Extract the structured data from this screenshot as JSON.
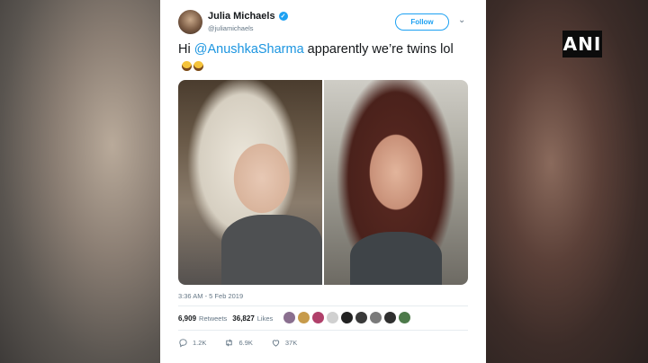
{
  "tweet": {
    "display_name": "Julia Michaels",
    "handle": "@juliamichaels",
    "follow_label": "Follow",
    "text_prefix": "Hi ",
    "mention": "@AnushkaSharma",
    "text_suffix": " apparently we’re twins lol",
    "timestamp": "3:36 AM - 5 Feb 2019",
    "retweets_count": "6,909",
    "retweets_label": "Retweets",
    "likes_count": "36,827",
    "likes_label": "Likes",
    "replies": "1.2K",
    "retweets_short": "6.9K",
    "likes_short": "37K"
  },
  "overlay": {
    "logo_text": "ANI"
  },
  "icons": [
    "verified-badge-icon",
    "chevron-down-icon",
    "reply-icon",
    "retweet-icon",
    "like-icon"
  ],
  "colors": {
    "twitter_blue": "#1da1f2",
    "mention_blue": "#1b95e0",
    "text_dark": "#14171a",
    "text_muted": "#657786"
  },
  "likers": [
    "#8a6f8f",
    "#c79b4b",
    "#b0406a",
    "#d0d0d0",
    "#222222",
    "#3a3a3a",
    "#7a7a7a",
    "#2f2f2f",
    "#4d7a4a"
  ]
}
